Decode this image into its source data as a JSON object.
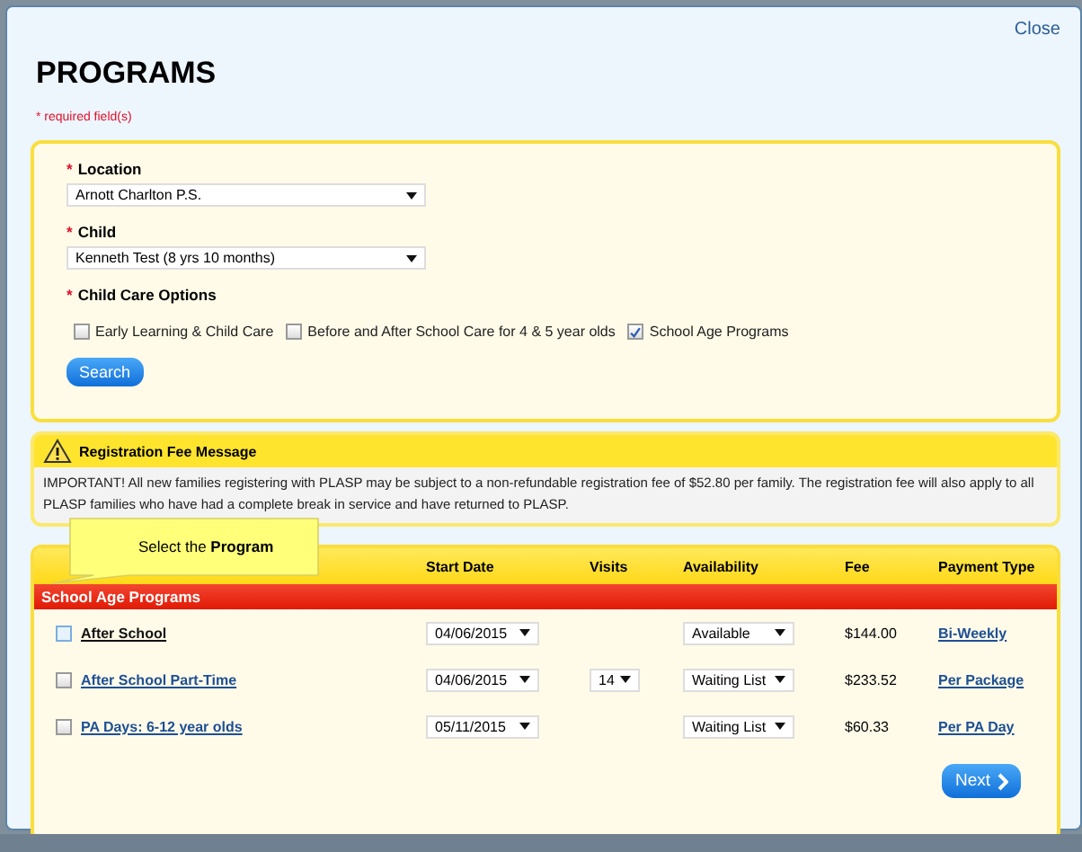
{
  "dialog": {
    "close": "Close",
    "title": "PROGRAMS",
    "required_note": "* required field(s)"
  },
  "form": {
    "fields": [
      {
        "marker": "*",
        "label": "Location",
        "value": "Arnott Charlton P.S."
      },
      {
        "marker": "*",
        "label": "Child",
        "value": "Kenneth Test (8 yrs 10 months)"
      }
    ],
    "options_marker": "*",
    "options_label": "Child Care Options",
    "options": [
      {
        "label": "Early Learning & Child Care",
        "checked": false
      },
      {
        "label": "Before and After School Care for 4 & 5 year olds",
        "checked": false
      },
      {
        "label": "School Age Programs",
        "checked": true
      }
    ],
    "search_button": "Search"
  },
  "message": {
    "title": "Registration Fee Message",
    "text": "IMPORTANT! All new families registering with PLASP may be subject to a non-refundable registration fee of $52.80 per family. The registration fee will also apply to all PLASP families who have had a complete break in service and have returned to PLASP."
  },
  "callout": {
    "before": "Select the ",
    "bold": "Program"
  },
  "table": {
    "columns": [
      "Start Date",
      "Visits",
      "Availability",
      "Fee",
      "Payment Type"
    ],
    "section": "School Age Programs",
    "rows": [
      {
        "checked": false,
        "hovered": true,
        "name": "After School",
        "start_date": "04/06/2015",
        "availability": "Available",
        "fee": "$144.00",
        "payment": "Bi-Weekly"
      },
      {
        "checked": false,
        "hovered": false,
        "name": "After School Part-Time",
        "start_date": "04/06/2015",
        "visits": "14",
        "availability": "Waiting List",
        "fee": "$233.52",
        "payment": "Per Package"
      },
      {
        "checked": false,
        "hovered": false,
        "name": "PA Days: 6-12 year olds",
        "start_date": "05/11/2015",
        "availability": "Waiting List",
        "fee": "$60.33",
        "payment": "Per PA Day"
      }
    ]
  },
  "next_button": "Next"
}
